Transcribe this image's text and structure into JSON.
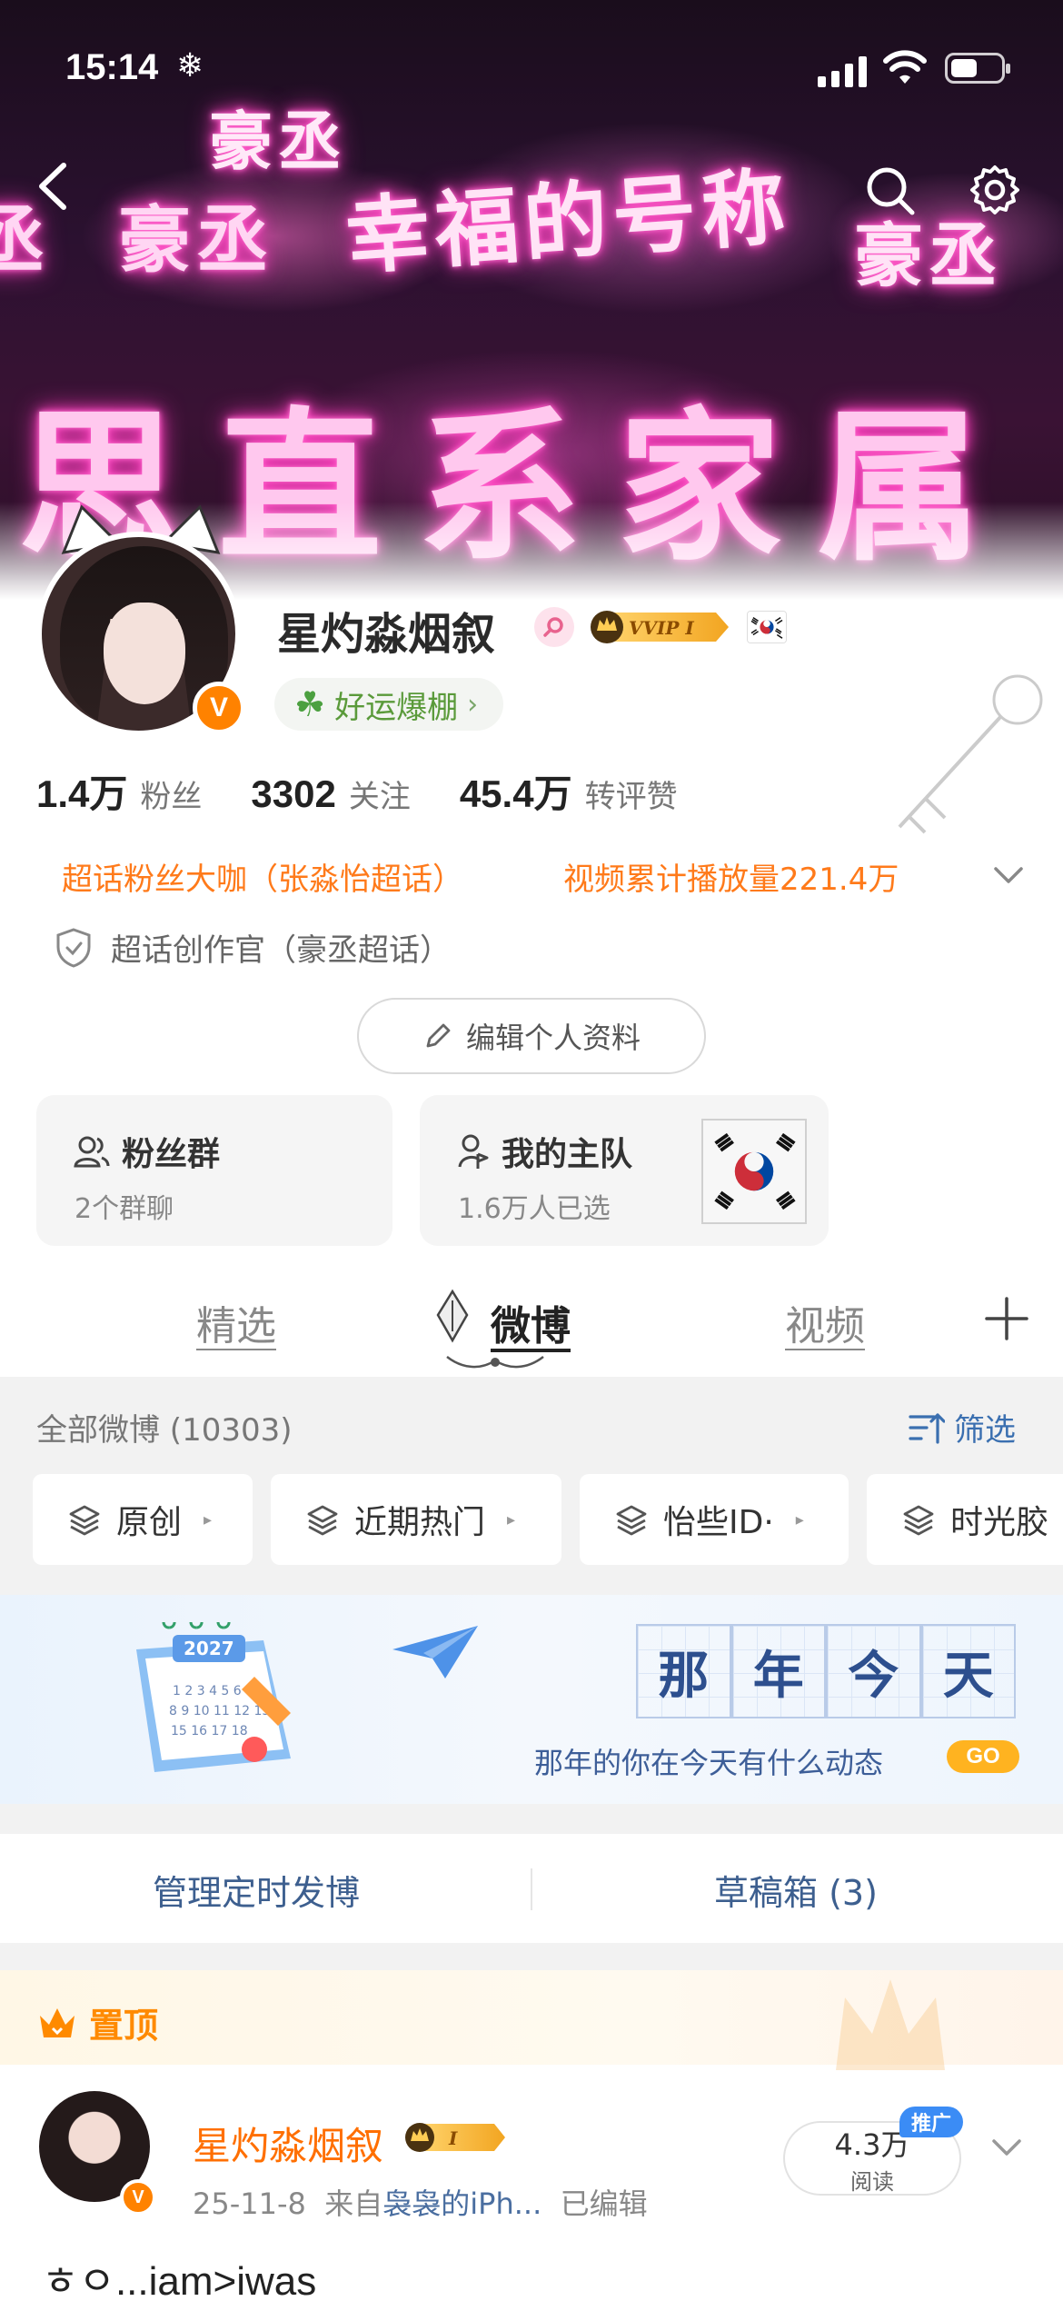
{
  "status_bar": {
    "time": "15:14",
    "extra_icon": "snowflake-icon"
  },
  "banner": {
    "neon_texts": [
      "幸福的号称",
      "豪丞",
      "豪丞",
      "思直系家属",
      "丞",
      "豪丞"
    ]
  },
  "profile": {
    "name": "星灼淼烟叙",
    "vip_label": "VVIP I",
    "luck_label": "好运爆棚",
    "stats": [
      {
        "num": "1.4万",
        "label": "粉丝"
      },
      {
        "num": "3302",
        "label": "关注"
      },
      {
        "num": "45.4万",
        "label": "转评赞"
      }
    ],
    "honors": [
      "超话粉丝大咖（张淼怡超话）",
      "视频累计播放量221.4万"
    ],
    "creator": "超话创作官（豪丞超话）",
    "edit_button": "编辑个人资料",
    "v_badge": "V"
  },
  "cards": {
    "fans": {
      "title": "粉丝群",
      "sub": "2个群聊"
    },
    "team": {
      "title": "我的主队",
      "sub": "1.6万人已选"
    }
  },
  "tabs": [
    {
      "label": "精选"
    },
    {
      "label": "微博"
    },
    {
      "label": "视频"
    }
  ],
  "feed": {
    "all_weibo": "全部微博 (10303)",
    "filter": "筛选",
    "chips": [
      "原创",
      "近期热门",
      "怡些ID·",
      "时光胶"
    ],
    "promo": {
      "chars": [
        "那",
        "年",
        "今",
        "天"
      ],
      "line": "那年的你在今天有什么动态",
      "go": "GO",
      "calendar_year": "2027"
    },
    "actions": {
      "schedule": "管理定时发博",
      "drafts": "草稿箱 (3)"
    }
  },
  "post": {
    "pin_label": "置顶",
    "name": "星灼淼烟叙",
    "vip_label": "I",
    "date": "25-11-8",
    "source_prefix": "来自",
    "source": "袅袅的iPh...",
    "edited": "已编辑",
    "reads_num": "4.3万",
    "reads_label": "阅读",
    "promo_tag": "推广",
    "text": "ㅎㅇ...iam>iwas"
  },
  "colors": {
    "accent_orange": "#ff7a1a",
    "link_blue": "#3a6fb0",
    "brand_v": "#ff8200"
  }
}
